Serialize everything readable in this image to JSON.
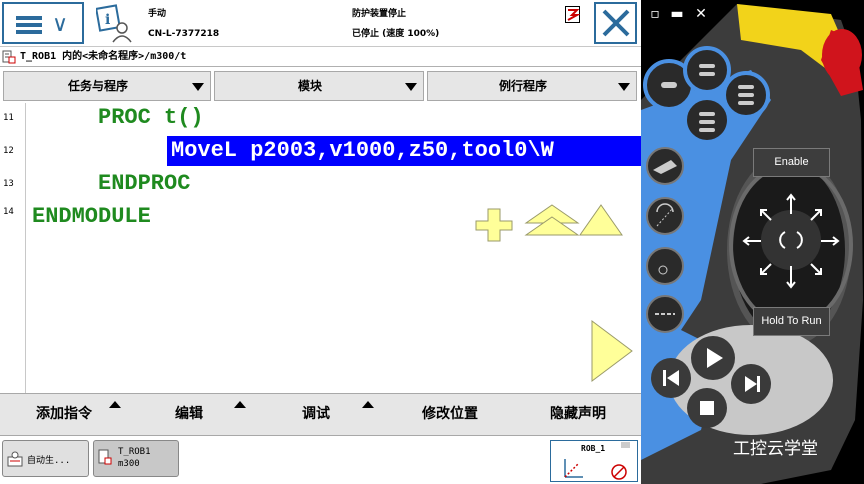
{
  "topbar": {
    "mode": "手动",
    "controller": "CN-L-7377218",
    "safety_state": "防护装置停止",
    "run_state": "已停止 (速度 100%)"
  },
  "path": {
    "text": "T_ROB1 内的<未命名程序>/m300/t"
  },
  "tabs": [
    {
      "label": "任务与程序"
    },
    {
      "label": "模块"
    },
    {
      "label": "例行程序"
    }
  ],
  "editor": {
    "lines": [
      {
        "num": "11",
        "code": "PROC t()"
      },
      {
        "num": "12",
        "code": "MoveL p2003,v1000,z50,tool0\\W"
      },
      {
        "num": "13",
        "code": "ENDPROC"
      },
      {
        "num": "14",
        "code": "ENDMODULE"
      }
    ],
    "selected_line": "12",
    "code_color": "#1f8a1f",
    "selection_color": "#0000ff"
  },
  "commands": [
    {
      "label": "添加指令"
    },
    {
      "label": "编辑"
    },
    {
      "label": "调试"
    },
    {
      "label": "修改位置"
    },
    {
      "label": "隐藏声明"
    }
  ],
  "taskbar": {
    "auto_task": "自动生...",
    "program_task_line1": "T_ROB1",
    "program_task_line2": "m300",
    "robot_label": "ROB_1"
  },
  "hardware": {
    "enable_label": "Enable",
    "hold_to_run_label": "Hold To Run",
    "watermark": "工控云学堂",
    "accent_blue": "#4a90e2",
    "emergency_red": "#d0141c",
    "body_yellow": "#f2d31a"
  },
  "colors": {
    "frame_blue": "#2b6b9c",
    "tab_gray": "#e6e6e6",
    "arrow_yellow": "#ffff99"
  }
}
